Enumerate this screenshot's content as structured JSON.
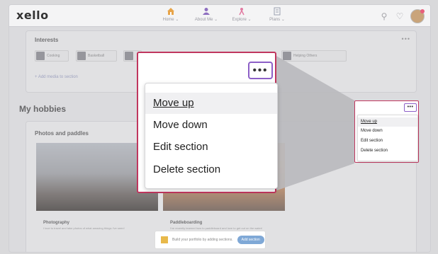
{
  "app": {
    "logo": "xello"
  },
  "nav": [
    {
      "label": "Home",
      "icon": "home-icon"
    },
    {
      "label": "About Me",
      "icon": "person-icon"
    },
    {
      "label": "Explore",
      "icon": "explore-icon"
    },
    {
      "label": "Plans",
      "icon": "plans-icon"
    }
  ],
  "header_icons": [
    "search-icon",
    "heart-icon",
    "avatar"
  ],
  "interests": {
    "title": "Interests",
    "chips": [
      "Cooking",
      "Basketball",
      "",
      "",
      "",
      "Helping Others"
    ],
    "add_media": "+ Add media to section"
  },
  "hobbies": {
    "title": "My hobbies",
    "section_title": "Photos and paddles",
    "cards": [
      {
        "title": "Photography",
        "desc": "I love to travel and take photos of what amazing things I've seen!"
      },
      {
        "title": "Paddleboarding",
        "desc": "I've recently learned how to paddleboard and love to get out on the water!"
      }
    ]
  },
  "bottom_bar": {
    "text": "Build your portfolio by adding sections.",
    "button": "Add section"
  },
  "menu": {
    "dots": "•••",
    "items": [
      "Move up",
      "Move down",
      "Edit section",
      "Delete section"
    ]
  },
  "colors": {
    "highlight_border": "#c0365e",
    "dots_border": "#8c5fc7",
    "button": "#7fa8d6"
  }
}
